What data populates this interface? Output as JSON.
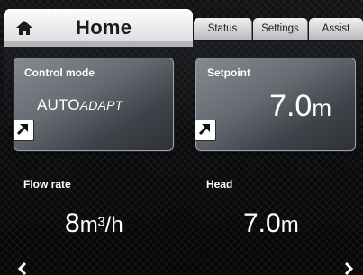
{
  "tabs": {
    "home": "Home",
    "status": "Status",
    "settings": "Settings",
    "assist": "Assist"
  },
  "cards": {
    "control_mode": {
      "label": "Control mode",
      "value_main": "AUTO",
      "value_sub": "ADAPT"
    },
    "setpoint": {
      "label": "Setpoint",
      "value": "7.0",
      "unit": "m"
    }
  },
  "readings": {
    "flow": {
      "label": "Flow rate",
      "value": "8",
      "unit": "m³/h"
    },
    "head": {
      "label": "Head",
      "value": "7.0",
      "unit": "m"
    }
  },
  "icons": {
    "home": "home-icon",
    "edit": "edit-arrow-icon",
    "left": "chevron-left-icon",
    "right": "chevron-right-icon"
  },
  "colors": {
    "active_tab": "#f4f5f6",
    "card": "#6a7076",
    "background": "#0c0d0e",
    "text": "#ffffff"
  }
}
